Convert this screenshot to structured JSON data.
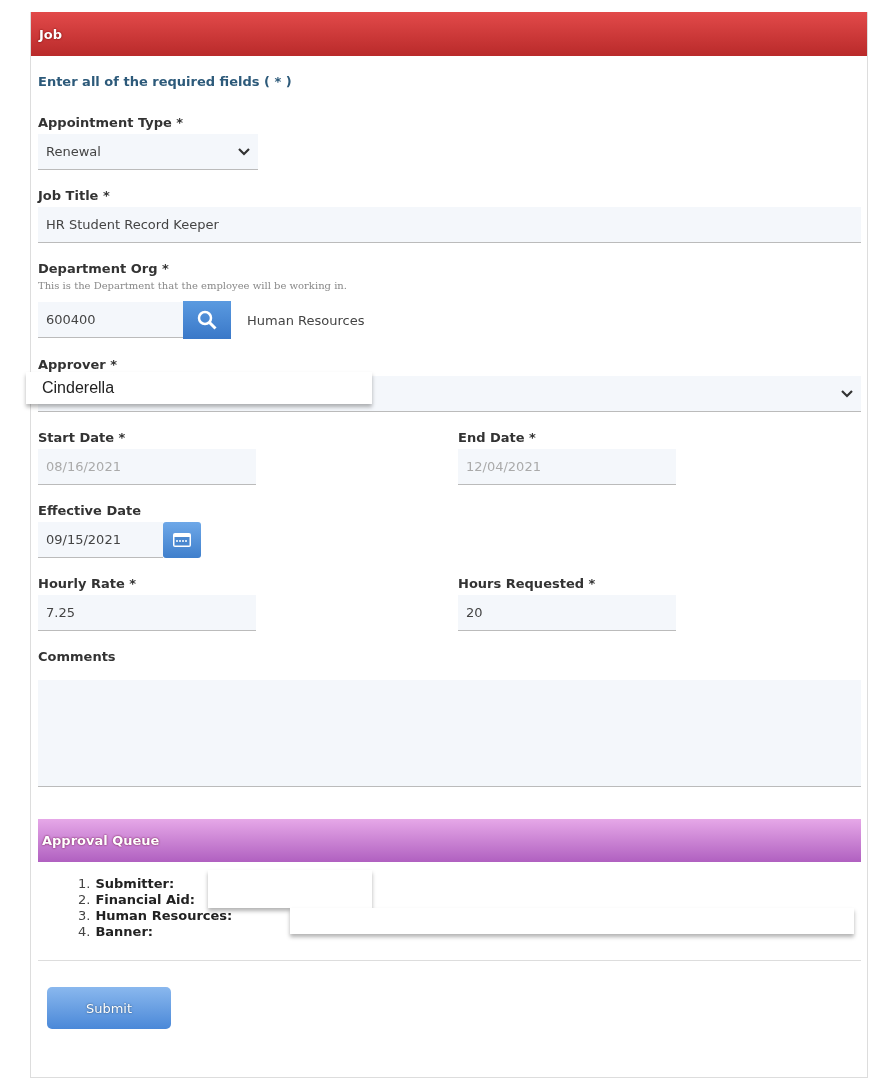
{
  "panel": {
    "title": "Job"
  },
  "intro": "Enter all of the required fields ( * )",
  "appointment_type": {
    "label": "Appointment Type *",
    "value": "Renewal"
  },
  "job_title": {
    "label": "Job Title *",
    "value": "HR Student Record Keeper"
  },
  "department": {
    "label": "Department Org *",
    "hint": "This is the Department that the employee will be working in.",
    "value": "600400",
    "name": "Human Resources"
  },
  "approver": {
    "label": "Approver *",
    "value": "Cinderella"
  },
  "dates": [
    {
      "label": "Start Date *",
      "value": "08/16/2021",
      "disabled": true
    },
    {
      "label": "End Date *",
      "value": "12/04/2021",
      "disabled": true
    }
  ],
  "effective_date": {
    "label": "Effective Date",
    "value": "09/15/2021"
  },
  "hours": [
    {
      "label": "Hourly Rate *",
      "value": "7.25",
      "disabled": false
    },
    {
      "label": "Hours Requested *",
      "value": "20",
      "disabled": false
    }
  ],
  "comments": {
    "label": "Comments"
  },
  "approval_queue": {
    "title": "Approval Queue",
    "items": [
      {
        "number": "1.",
        "label": "Submitter:"
      },
      {
        "number": "2.",
        "label": "Financial Aid:"
      },
      {
        "number": "3.",
        "label": "Human Resources:"
      },
      {
        "number": "4.",
        "label": "Banner:"
      }
    ]
  },
  "submit": "Submit"
}
